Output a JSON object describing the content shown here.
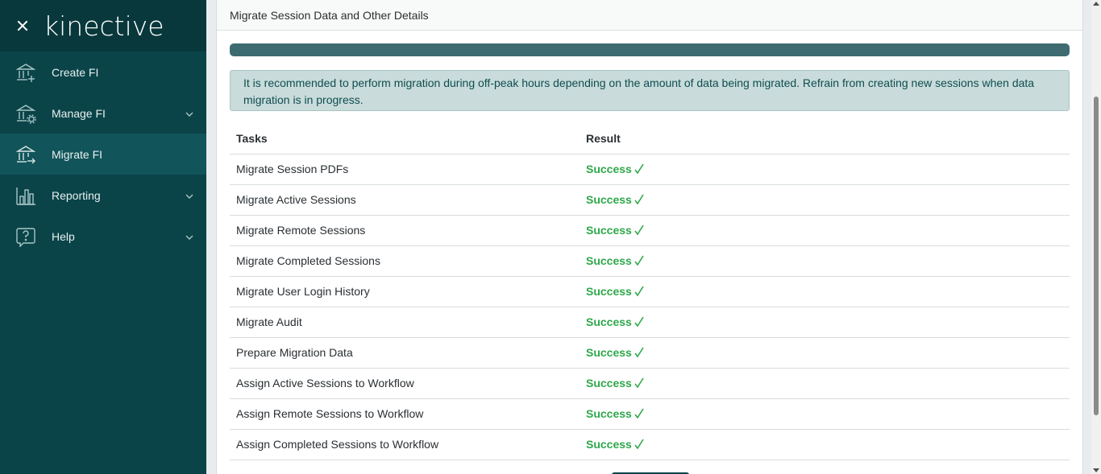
{
  "sidebar": {
    "logo": "kinective",
    "items": [
      {
        "label": "Create FI",
        "icon": "bank-add-icon",
        "expandable": false,
        "active": false
      },
      {
        "label": "Manage FI",
        "icon": "bank-settings-icon",
        "expandable": true,
        "active": false
      },
      {
        "label": "Migrate FI",
        "icon": "bank-migrate-icon",
        "expandable": false,
        "active": true
      },
      {
        "label": "Reporting",
        "icon": "bar-chart-icon",
        "expandable": true,
        "active": false
      },
      {
        "label": "Help",
        "icon": "help-icon",
        "expandable": true,
        "active": false
      }
    ]
  },
  "panel": {
    "title": "Migrate Session Data and Other Details",
    "progress": 1.0,
    "alert": "It is recommended to perform migration during off-peak hours depending on the amount of data being migrated. Refrain from creating new sessions when data migration is in progress."
  },
  "table": {
    "headers": {
      "tasks": "Tasks",
      "result": "Result"
    },
    "rows": [
      {
        "task": "Migrate Session PDFs",
        "result": "Success"
      },
      {
        "task": "Migrate Active Sessions",
        "result": "Success"
      },
      {
        "task": "Migrate Remote Sessions",
        "result": "Success"
      },
      {
        "task": "Migrate Completed Sessions",
        "result": "Success"
      },
      {
        "task": "Migrate User Login History",
        "result": "Success"
      },
      {
        "task": "Migrate Audit",
        "result": "Success"
      },
      {
        "task": "Prepare Migration Data",
        "result": "Success"
      },
      {
        "task": "Assign Active Sessions to Workflow",
        "result": "Success"
      },
      {
        "task": "Assign Remote Sessions to Workflow",
        "result": "Success"
      },
      {
        "task": "Assign Completed Sessions to Workflow",
        "result": "Success"
      }
    ]
  },
  "colors": {
    "sidebar_bg": "#0a4449",
    "success": "#2ea84a",
    "progress": "#3d6b70",
    "alert_bg": "#c9dbdb"
  }
}
